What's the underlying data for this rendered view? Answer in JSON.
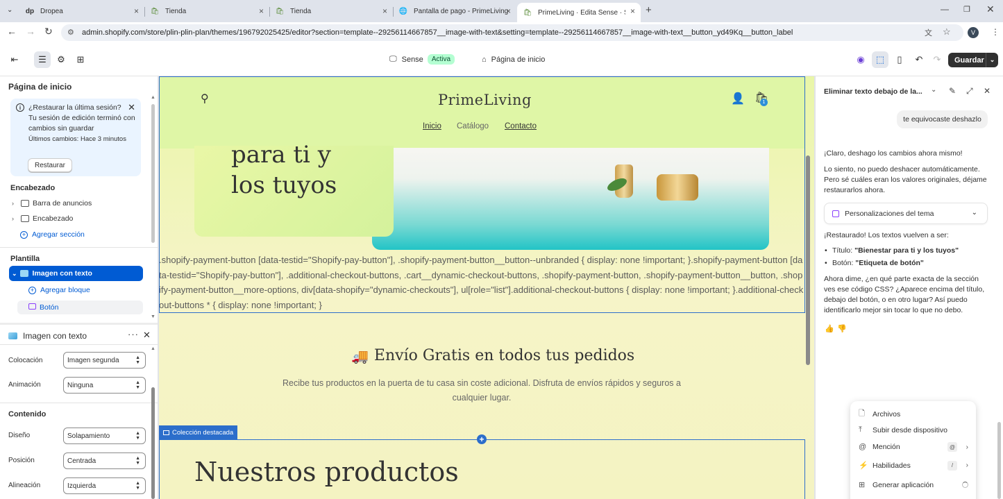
{
  "browser": {
    "tabs": [
      {
        "title": "Dropea"
      },
      {
        "title": "Tienda"
      },
      {
        "title": "Tienda"
      },
      {
        "title": "Pantalla de pago - PrimeLiving"
      },
      {
        "title": "PrimeLiving · Edita Sense · Shop"
      }
    ],
    "url": "admin.shopify.com/store/plin-plin-plan/themes/196792025425/editor?section=template--29256114667857__image-with-text&setting=template--29256114667857__image-with-text__button_yd49Kq__button_label",
    "profile_initial": "V"
  },
  "topbar": {
    "theme_name": "Sense",
    "theme_status": "Activa",
    "page_name": "Página de inicio",
    "save_label": "Guardar"
  },
  "left": {
    "title": "Página de inicio",
    "banner": {
      "heading": "¿Restaurar la última sesión?",
      "body": "Tu sesión de edición terminó con cambios sin guardar",
      "last_changes": "Últimos cambios: Hace 3 minutos",
      "button": "Restaurar"
    },
    "header_section": "Encabezado",
    "header_items": [
      "Barra de anuncios",
      "Encabezado"
    ],
    "add_section": "Agregar sección",
    "template_section": "Plantilla",
    "template_selected": "Imagen con texto",
    "add_block": "Agregar bloque",
    "block_button": "Botón",
    "block_panel_title": "Imagen con texto",
    "fields": [
      {
        "label": "Colocación",
        "value": "Imagen segunda"
      },
      {
        "label": "Animación",
        "value": "Ninguna"
      }
    ],
    "content_heading": "Contenido",
    "content_fields": [
      {
        "label": "Diseño",
        "value": "Solapamiento"
      },
      {
        "label": "Posición",
        "value": "Centrada"
      },
      {
        "label": "Alineación",
        "value": "Izquierda"
      }
    ]
  },
  "store": {
    "logo": "PrimeLiving",
    "cart_count": "1",
    "nav": [
      "Inicio",
      "Catálogo",
      "Contacto"
    ],
    "hero_lines": [
      "para ti y",
      "los tuyos"
    ],
    "css_dump": ".shopify-payment-button [data-testid=\"Shopify-pay-button\"], .shopify-payment-button__button--unbranded { display: none !important; }.shopify-payment-button [data-testid=\"Shopify-pay-button\"], .additional-checkout-buttons, .cart__dynamic-checkout-buttons, .shopify-payment-button, .shopify-payment-button__button, .shopify-payment-button__more-options, div[data-shopify=\"dynamic-checkouts\"], ul[role=\"list\"].additional-checkout-buttons { display: none !important; }.additional-checkout-buttons * { display: none !important; }",
    "shipping_title": "Envío Gratis en todos tus pedidos",
    "shipping_text": "Recibe tus productos en la puerta de tu casa sin coste adicional. Disfruta de envíos rápidos y seguros a cualquier lugar.",
    "collection_tag": "Colección destacada",
    "products_title": "Nuestros productos"
  },
  "assistant": {
    "title": "Eliminar texto debajo de la...",
    "user_msg": "te equivocaste deshazlo",
    "reply1": "¡Claro, deshago los cambios ahora mismo!",
    "reply2": "Lo siento, no puedo deshacer automáticamente. Pero sé cuáles eran los valores originales, déjame restaurarlos ahora.",
    "accordion": "Personalizaciones del tema",
    "restored": "¡Restaurado! Los textos vuelven a ser:",
    "bullets": [
      {
        "label": "Título:",
        "value": "\"Bienestar para ti y los tuyos\""
      },
      {
        "label": "Botón:",
        "value": "\"Etiqueta de botón\""
      }
    ],
    "question": "Ahora dime, ¿en qué parte exacta de la sección ves ese código CSS? ¿Aparece encima del título, debajo del botón, o en otro lugar? Así puedo identificarlo mejor sin tocar lo que no debo.",
    "menu": [
      {
        "label": "Archivos",
        "icon": "file-icon"
      },
      {
        "label": "Subir desde dispositivo",
        "icon": "upload-icon"
      },
      {
        "label": "Mención",
        "icon": "mention-icon",
        "key": "@"
      },
      {
        "label": "Habilidades",
        "icon": "bolt-icon",
        "key": "/"
      },
      {
        "label": "Generar aplicación",
        "icon": "app-icon"
      }
    ]
  },
  "colors": {
    "accent": "#005bd3",
    "selection": "#2c6ecb",
    "active_badge": "#b4fed2",
    "store_bg": "#e9f6a8"
  }
}
